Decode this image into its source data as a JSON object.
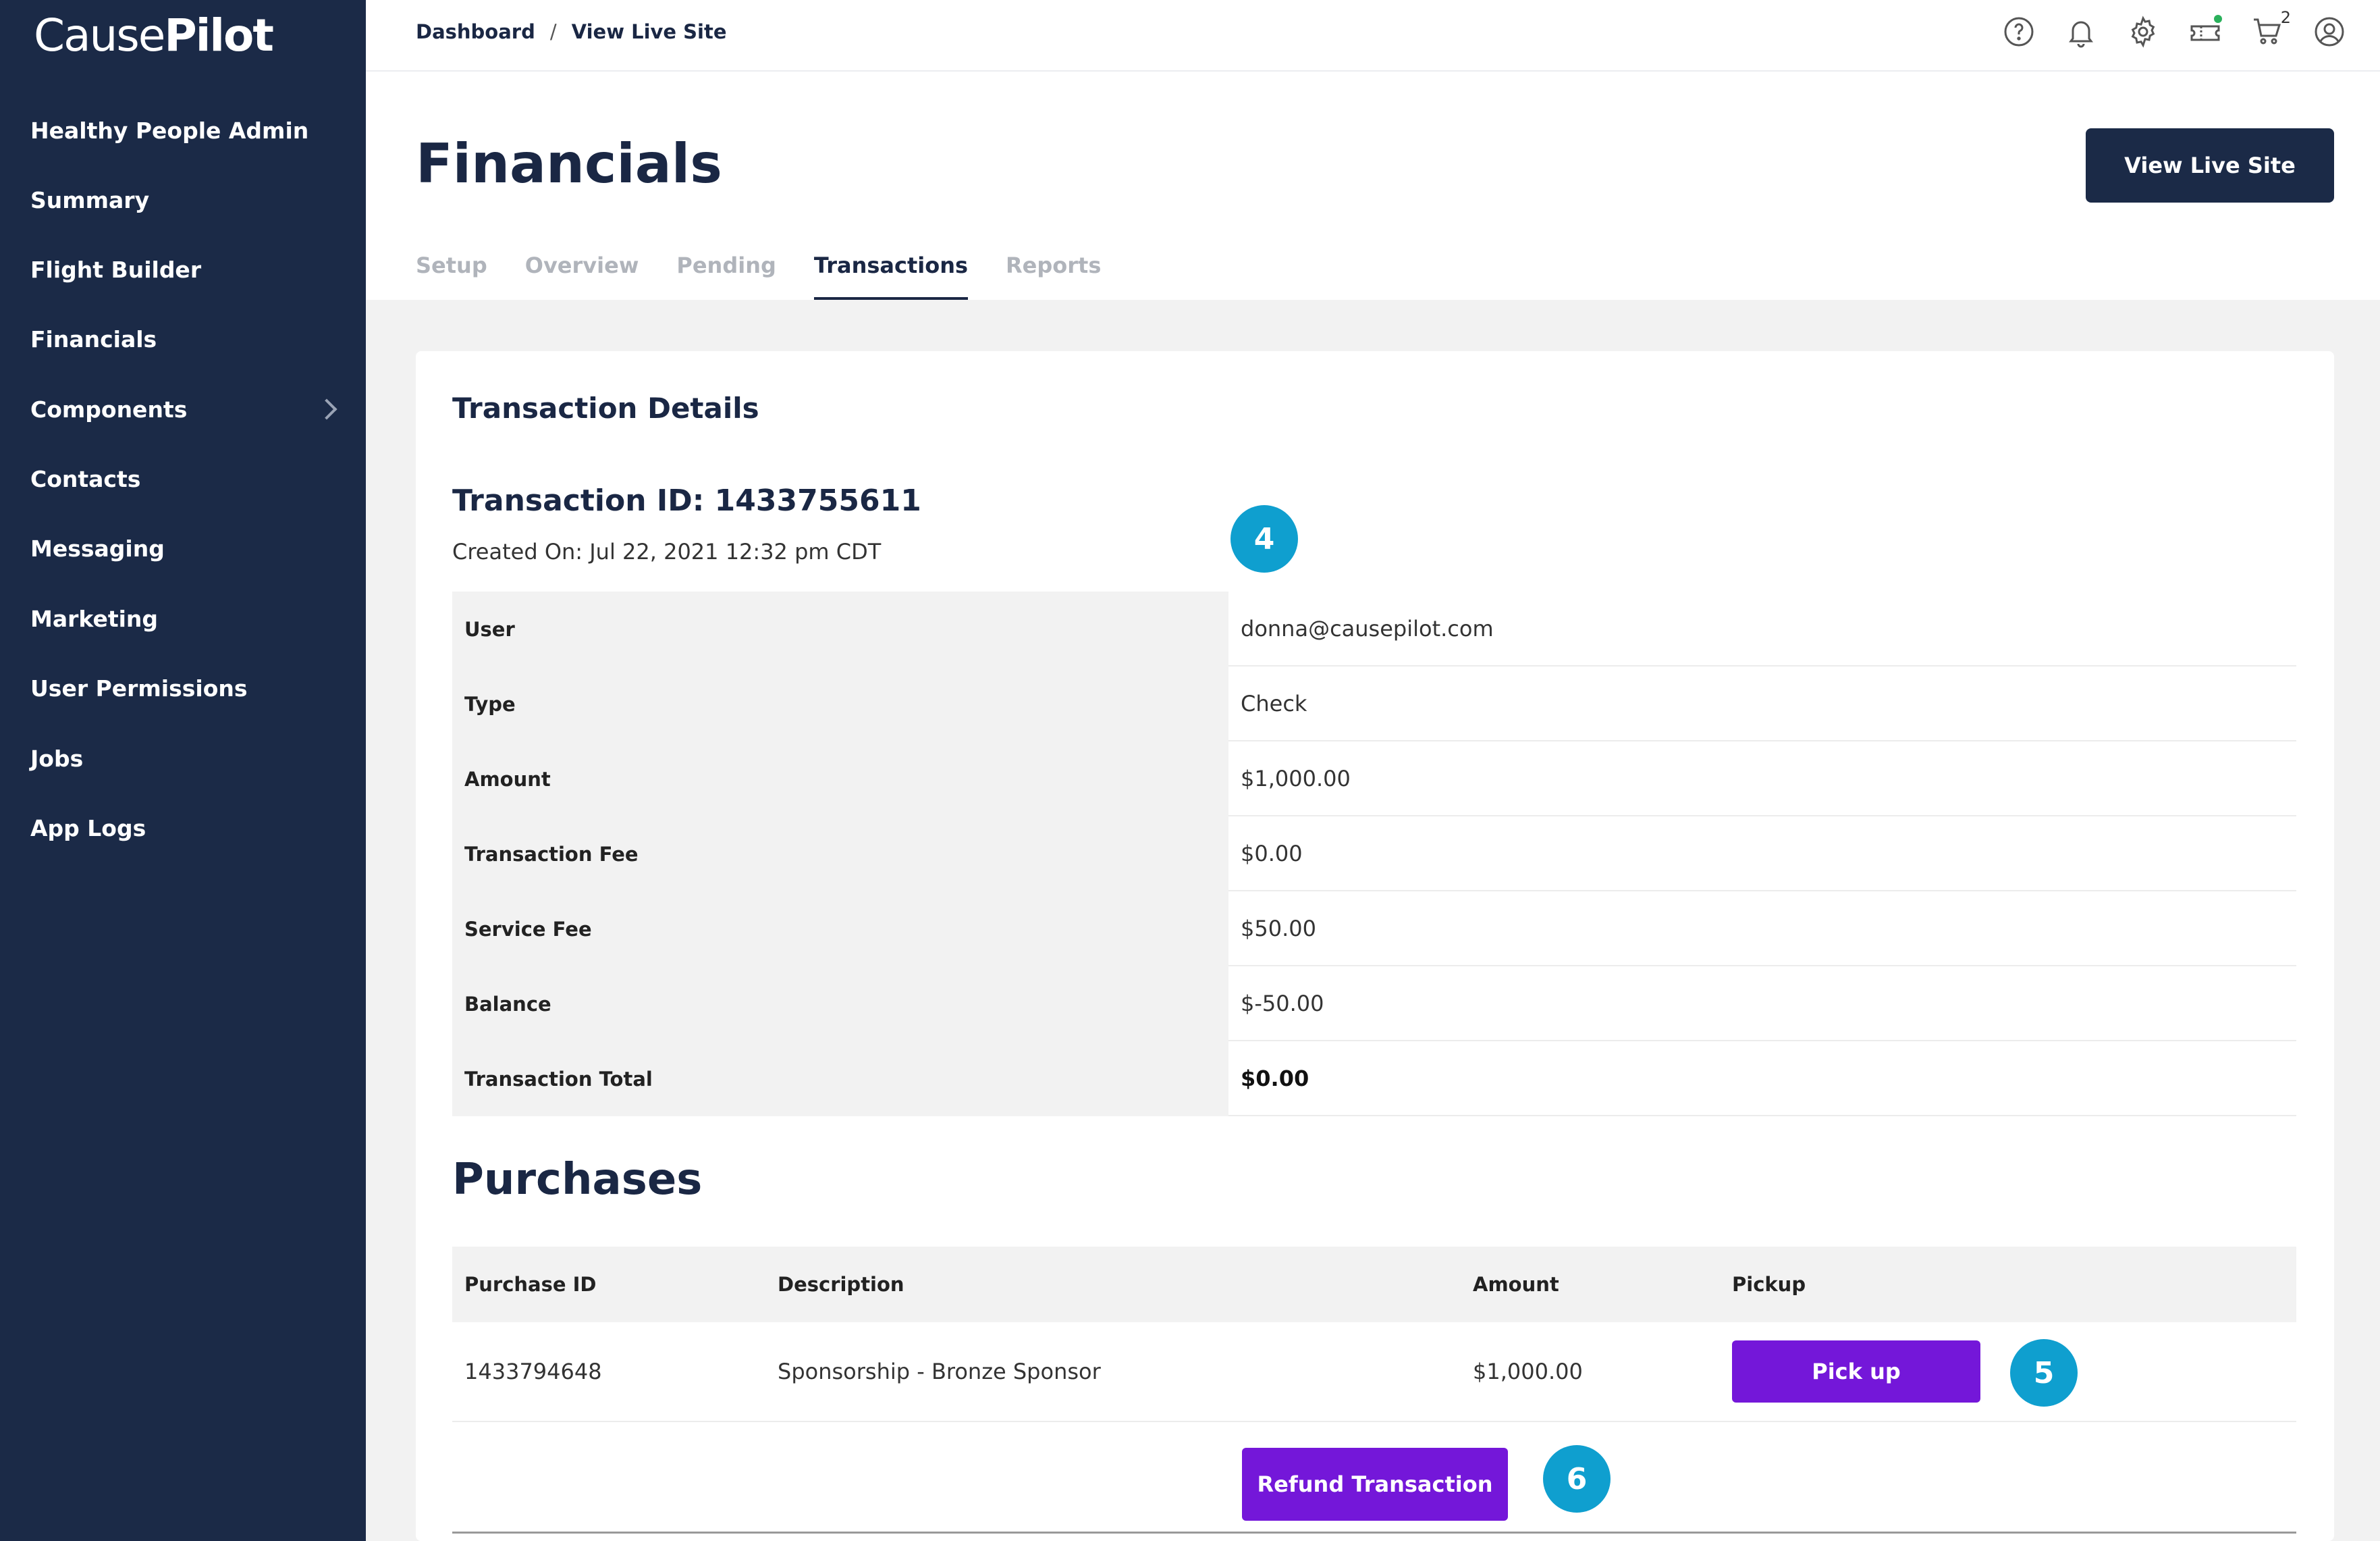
{
  "app": {
    "logo_part1": "Cause",
    "logo_part2": "Pilot"
  },
  "sidebar": {
    "items": [
      {
        "label": "Healthy People Admin"
      },
      {
        "label": "Summary"
      },
      {
        "label": "Flight Builder"
      },
      {
        "label": "Financials"
      },
      {
        "label": "Components"
      },
      {
        "label": "Contacts"
      },
      {
        "label": "Messaging"
      },
      {
        "label": "Marketing"
      },
      {
        "label": "User Permissions"
      },
      {
        "label": "Jobs"
      },
      {
        "label": "App Logs"
      }
    ]
  },
  "topbar": {
    "breadcrumb": [
      "Dashboard",
      "/",
      "View Live Site"
    ],
    "icons": [
      "help-icon",
      "bell-icon",
      "gear-icon",
      "ticket-icon",
      "cart-icon",
      "user-icon"
    ],
    "cart_count": "2",
    "status_color": "#2ab05b"
  },
  "header": {
    "title": "Financials",
    "live_button": "View Live Site",
    "tabs": [
      "Setup",
      "Overview",
      "Pending",
      "Transactions",
      "Reports"
    ],
    "active_tab": "Transactions"
  },
  "transaction": {
    "section_title": "Transaction Details",
    "id_label": "Transaction ID: 1433755611",
    "created_on": "Created On: Jul 22, 2021 12:32 pm CDT",
    "rows": [
      {
        "label": "User",
        "value": "donna@causepilot.com"
      },
      {
        "label": "Type",
        "value": "Check"
      },
      {
        "label": "Amount",
        "value": "$1,000.00"
      },
      {
        "label": "Transaction Fee",
        "value": "$0.00"
      },
      {
        "label": "Service Fee",
        "value": "$50.00"
      },
      {
        "label": "Balance",
        "value": "$-50.00"
      },
      {
        "label": "Transaction Total",
        "value": "$0.00"
      }
    ]
  },
  "purchases": {
    "title": "Purchases",
    "headers": [
      "Purchase ID",
      "Description",
      "Amount",
      "Pickup"
    ],
    "rows": [
      {
        "id": "1433794648",
        "description": "Sponsorship - Bronze Sponsor",
        "amount": "$1,000.00",
        "pickup_label": "Pick up"
      }
    ],
    "refund_label": "Refund Transaction"
  },
  "markers": [
    "4",
    "5",
    "6"
  ],
  "colors": {
    "sidebar": "#1b2a47",
    "accent_purple": "#7417d9",
    "marker_blue": "#0f9fcf"
  }
}
